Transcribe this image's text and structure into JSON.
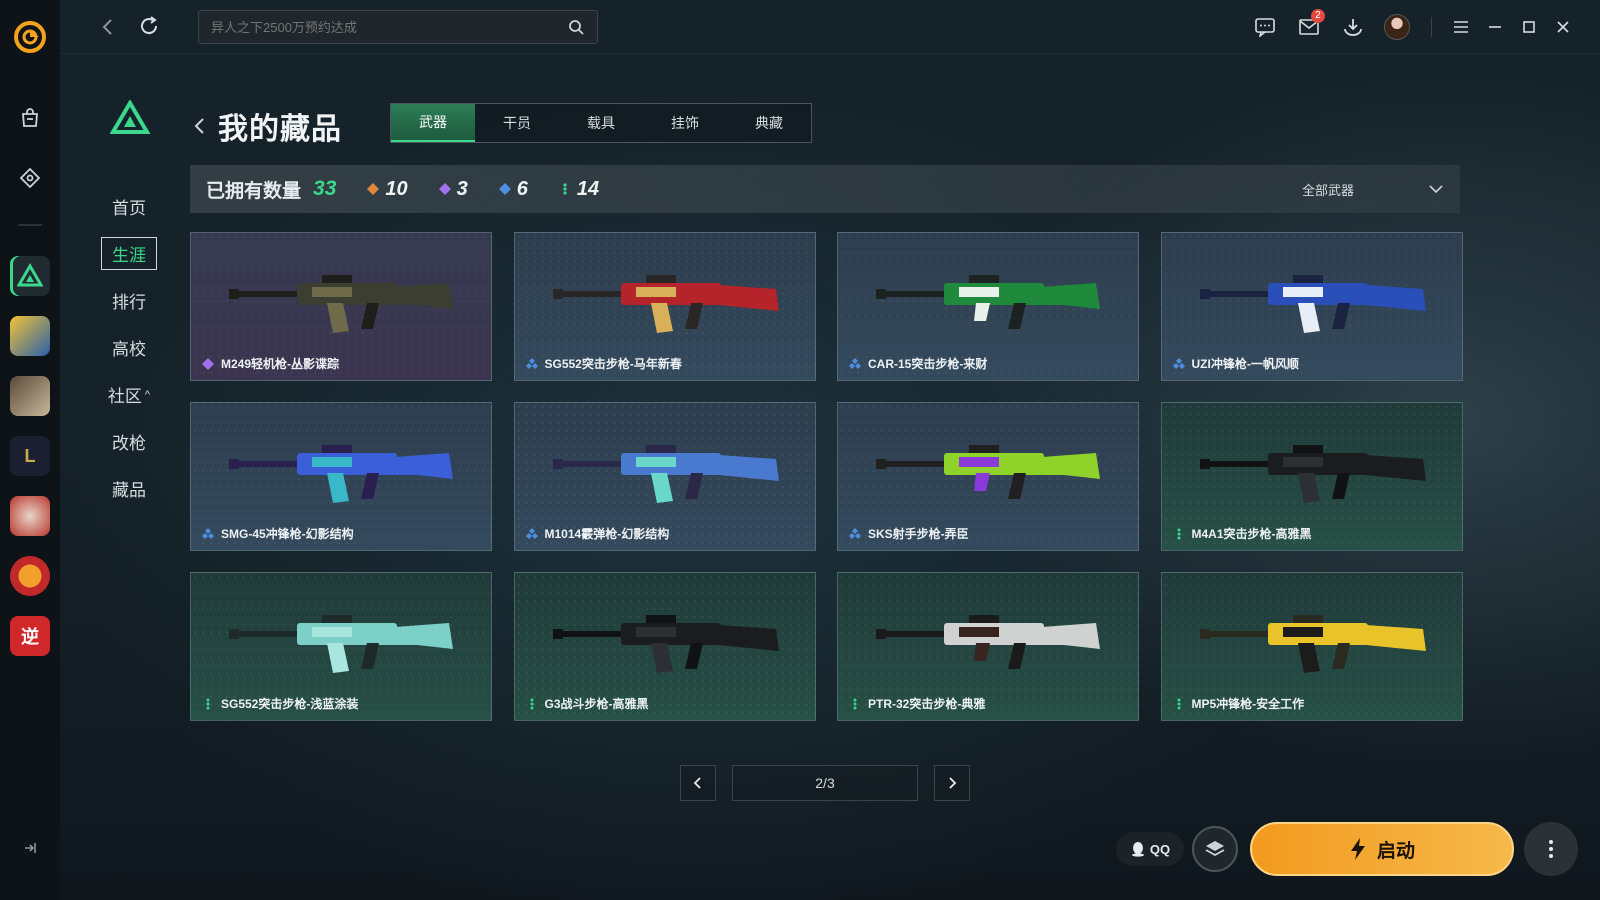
{
  "search": {
    "placeholder": "异人之下2500万预约达成"
  },
  "topbar": {
    "mail_badge": "2"
  },
  "subnav": {
    "items": [
      {
        "label": "首页",
        "active": false
      },
      {
        "label": "生涯",
        "active": true
      },
      {
        "label": "排行",
        "active": false
      },
      {
        "label": "高校",
        "active": false
      },
      {
        "label": "社区",
        "active": false,
        "caret": "^"
      },
      {
        "label": "改枪",
        "active": false
      },
      {
        "label": "藏品",
        "active": false
      }
    ]
  },
  "header": {
    "title": "我的藏品"
  },
  "tabs": [
    {
      "label": "武器",
      "active": true
    },
    {
      "label": "干员",
      "active": false
    },
    {
      "label": "载具",
      "active": false
    },
    {
      "label": "挂饰",
      "active": false
    },
    {
      "label": "典藏",
      "active": false
    }
  ],
  "stats": {
    "label": "已拥有数量",
    "total": "33",
    "rarities": [
      {
        "color": "#e0883a",
        "count": "10",
        "icon": "diamond-orange-icon"
      },
      {
        "color": "#a070ee",
        "count": "3",
        "icon": "diamond-purple-icon"
      },
      {
        "color": "#4c8fe0",
        "count": "6",
        "icon": "diamond-blue-icon"
      },
      {
        "color": "#3ad78c",
        "count": "14",
        "icon": "dots-green-icon"
      }
    ],
    "filter_label": "全部武器"
  },
  "items": [
    {
      "name": "M249轻机枪-丛影谍踪",
      "rarity": "purple",
      "palette": [
        "#3b3e30",
        "#6e6a4a",
        "#1e1e1a"
      ]
    },
    {
      "name": "SG552突击步枪-马年新春",
      "rarity": "blue",
      "palette": [
        "#b5242a",
        "#d8b05a",
        "#2a2626"
      ]
    },
    {
      "name": "CAR-15突击步枪-来财",
      "rarity": "blue",
      "palette": [
        "#1f8a3c",
        "#e9efe9",
        "#1c2220"
      ]
    },
    {
      "name": "UZI冲锋枪-一帆风顺",
      "rarity": "blue",
      "palette": [
        "#2a4fb8",
        "#e8eef6",
        "#1a2340"
      ]
    },
    {
      "name": "SMG-45冲锋枪-幻影结构",
      "rarity": "blue",
      "palette": [
        "#3a5fd8",
        "#38b8c8",
        "#2a2050"
      ]
    },
    {
      "name": "M1014霰弹枪-幻影结构",
      "rarity": "blue",
      "palette": [
        "#4a7ad0",
        "#6ad8c8",
        "#2a2848"
      ]
    },
    {
      "name": "SKS射手步枪-弄臣",
      "rarity": "blue",
      "palette": [
        "#8fd22a",
        "#8a3ad8",
        "#202020"
      ]
    },
    {
      "name": "M4A1突击步枪-高雅黑",
      "rarity": "green",
      "palette": [
        "#1a1c1e",
        "#2c3034",
        "#101214"
      ]
    },
    {
      "name": "SG552突击步枪-浅蓝涂装",
      "rarity": "green",
      "palette": [
        "#7cd0c8",
        "#a8e6de",
        "#1e2a2a"
      ]
    },
    {
      "name": "G3战斗步枪-高雅黑",
      "rarity": "green",
      "palette": [
        "#1a1c1e",
        "#2c3034",
        "#101214"
      ]
    },
    {
      "name": "PTR-32突击步枪-典雅",
      "rarity": "green",
      "palette": [
        "#cfd2d0",
        "#3a2420",
        "#1a1a1a"
      ]
    },
    {
      "name": "MP5冲锋枪-安全工作",
      "rarity": "green",
      "palette": [
        "#e8c42a",
        "#1c1c1c",
        "#2a2a20"
      ]
    }
  ],
  "pager": {
    "text": "2/3"
  },
  "bottom": {
    "qq_label": "QQ",
    "launch_label": "启动"
  },
  "colors": {
    "accent_green": "#3ad78c",
    "launch_orange": "#f39a1f"
  }
}
